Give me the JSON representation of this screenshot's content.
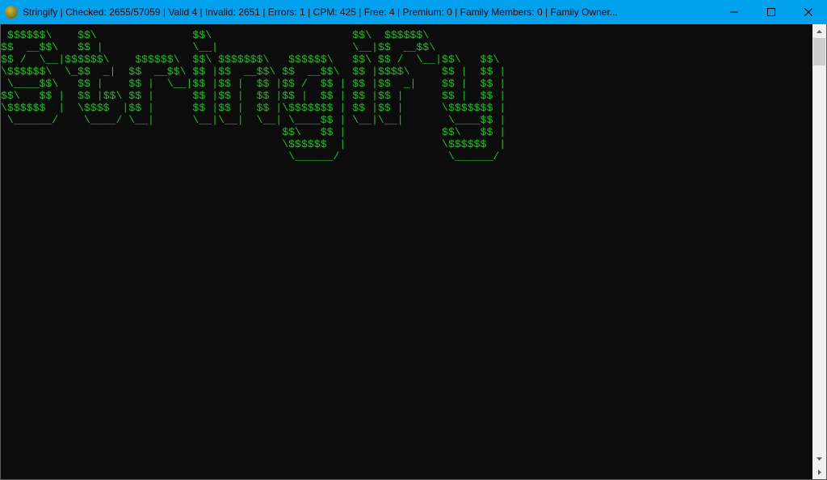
{
  "window": {
    "title": "Stringify | Checked: 2655/57059 | Valid 4 | Invalid: 2651 | Errors: 1 | CPM: 425 | Free: 4 | Premium: 0 | Family Members: 0 | Family Owner...",
    "stats": {
      "app_name": "Stringify",
      "checked": 2655,
      "total": 57059,
      "valid": 4,
      "invalid": 2651,
      "errors": 1,
      "cpm": 425,
      "free": 4,
      "premium": 0,
      "family_members": 0
    }
  },
  "terminal": {
    "ascii_art": " $$$$$$\\    $$\\               $$\\                      $$\\  $$$$$$\\            \n$$  __$$\\   $$ |              \\__|                     \\__|$$  __$$\\           \n$$ /  \\__|$$$$$$\\    $$$$$$\\  $$\\ $$$$$$$\\   $$$$$$\\   $$\\ $$ /  \\__|$$\\   $$\\ \n\\$$$$$$\\  \\_$$  _|  $$  __$$\\ $$ |$$  __$$\\ $$  __$$\\  $$ |$$$$\\     $$ |  $$ |\n \\____$$\\   $$ |    $$ |  \\__|$$ |$$ |  $$ |$$ /  $$ | $$ |$$  _|    $$ |  $$ |\n$$\\   $$ |  $$ |$$\\ $$ |      $$ |$$ |  $$ |$$ |  $$ | $$ |$$ |      $$ |  $$ |\n\\$$$$$$  |  \\$$$$  |$$ |      $$ |$$ |  $$ |\\$$$$$$$ | $$ |$$ |      \\$$$$$$$ |\n \\______/    \\____/ \\__|      \\__|\\__|  \\__| \\____$$ | \\__|\\__|       \\____$$ |\n                                            $$\\   $$ |               $$\\   $$ |\n                                            \\$$$$$$  |               \\$$$$$$  |\n                                             \\______/                 \\______/ "
  },
  "colors": {
    "titlebar_bg": "#00a2ed",
    "terminal_bg": "#0c0c0c",
    "ascii_green": "#15c215"
  }
}
